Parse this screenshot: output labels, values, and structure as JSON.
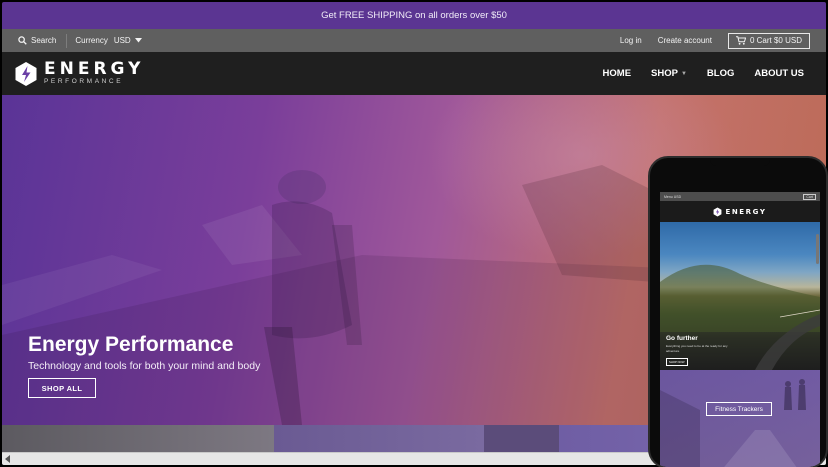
{
  "announcement": "Get FREE SHIPPING on all orders over $50",
  "utility": {
    "search_label": "Search",
    "currency_label": "Currency",
    "currency_value": "USD",
    "login": "Log in",
    "create_account": "Create account",
    "cart": "0 Cart $0 USD"
  },
  "brand": {
    "name": "ENERGY",
    "tagline": "PERFORMANCE"
  },
  "nav": {
    "home": "HOME",
    "shop": "SHOP",
    "blog": "BLOG",
    "about": "ABOUT US"
  },
  "hero": {
    "title": "Energy Performance",
    "subtitle": "Technology and tools for both your mind and body",
    "button": "SHOP ALL"
  },
  "phone": {
    "util_left": "Menu   USD",
    "util_cart": "Cart",
    "brand": "ENERGY",
    "hero_title": "Go further",
    "hero_sub": "Everything you need to be at the ready for any adventure",
    "hero_button": "SHOP NOW",
    "tile_label": "Fitness Trackers"
  },
  "colors": {
    "announcement_bg": "#5b3592",
    "utility_bg": "#5f5f5f",
    "nav_bg": "#1f1f1f",
    "hero_left": "#5a3497",
    "hero_right": "#c4726c"
  }
}
